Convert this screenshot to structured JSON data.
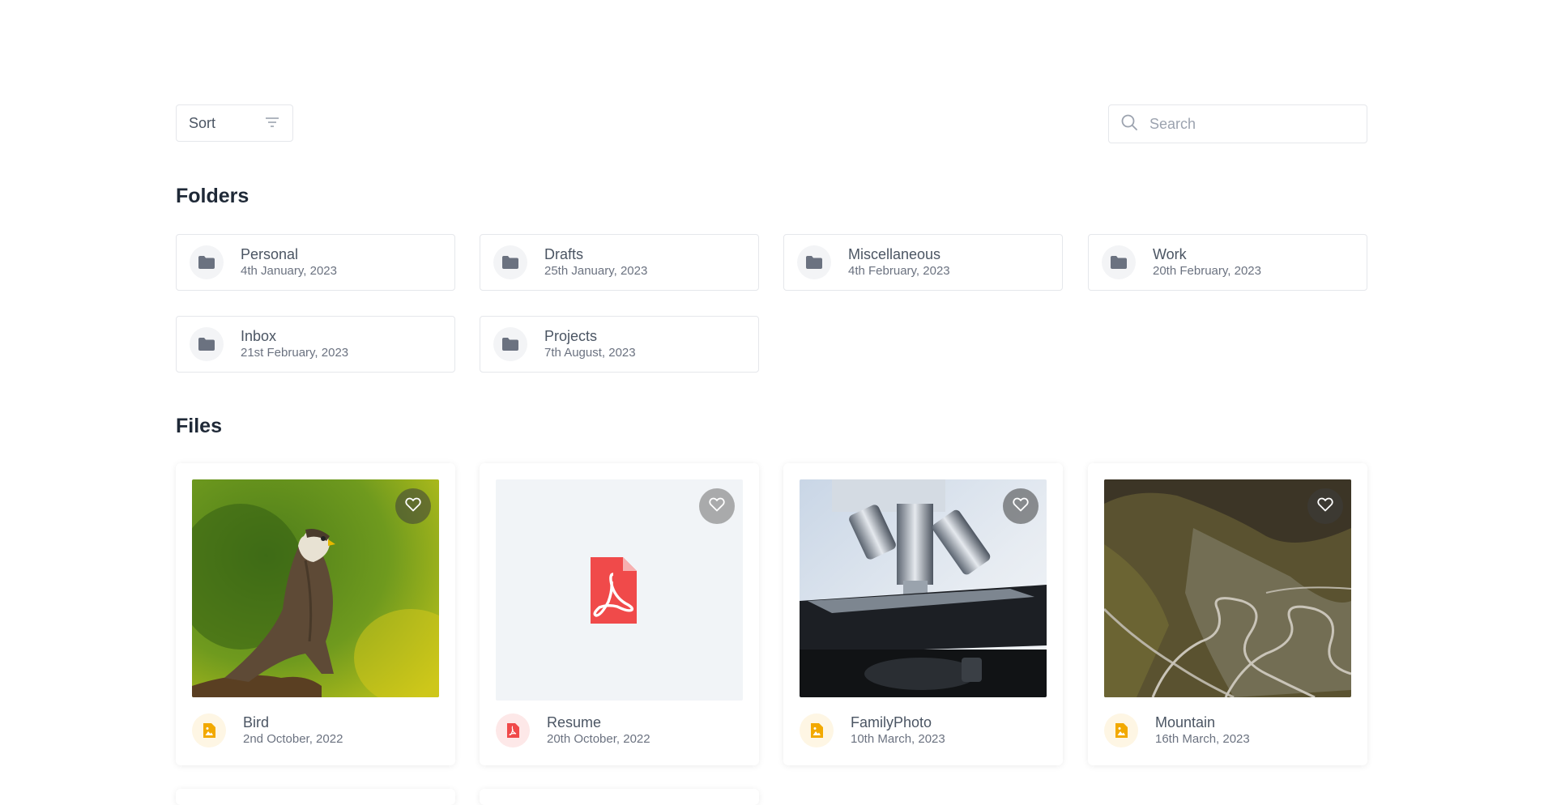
{
  "toolbar": {
    "sort_label": "Sort",
    "search_placeholder": "Search"
  },
  "sections": {
    "folders_title": "Folders",
    "files_title": "Files"
  },
  "folders": [
    {
      "name": "Personal",
      "date": "4th January, 2023"
    },
    {
      "name": "Drafts",
      "date": "25th January, 2023"
    },
    {
      "name": "Miscellaneous",
      "date": "4th February, 2023"
    },
    {
      "name": "Work",
      "date": "20th February, 2023"
    },
    {
      "name": "Inbox",
      "date": "21st February, 2023"
    },
    {
      "name": "Projects",
      "date": "7th August, 2023"
    }
  ],
  "files": [
    {
      "name": "Bird",
      "date": "2nd October, 2022",
      "type_icon": "image-file-icon",
      "thumbnail": "bird-photo"
    },
    {
      "name": "Resume",
      "date": "20th October, 2022",
      "type_icon": "pdf-file-icon",
      "thumbnail": "pdf-placeholder"
    },
    {
      "name": "FamilyPhoto",
      "date": "10th March, 2023",
      "type_icon": "image-file-icon",
      "thumbnail": "microscope-photo"
    },
    {
      "name": "Mountain",
      "date": "16th March, 2023",
      "type_icon": "image-file-icon",
      "thumbnail": "mountain-road-photo"
    }
  ],
  "colors": {
    "image_icon": "#f2a900",
    "image_icon_bg": "#fef6e4",
    "pdf_icon": "#f04a4a",
    "pdf_icon_bg": "#fde8e8",
    "folder_icon": "#6b7280"
  }
}
